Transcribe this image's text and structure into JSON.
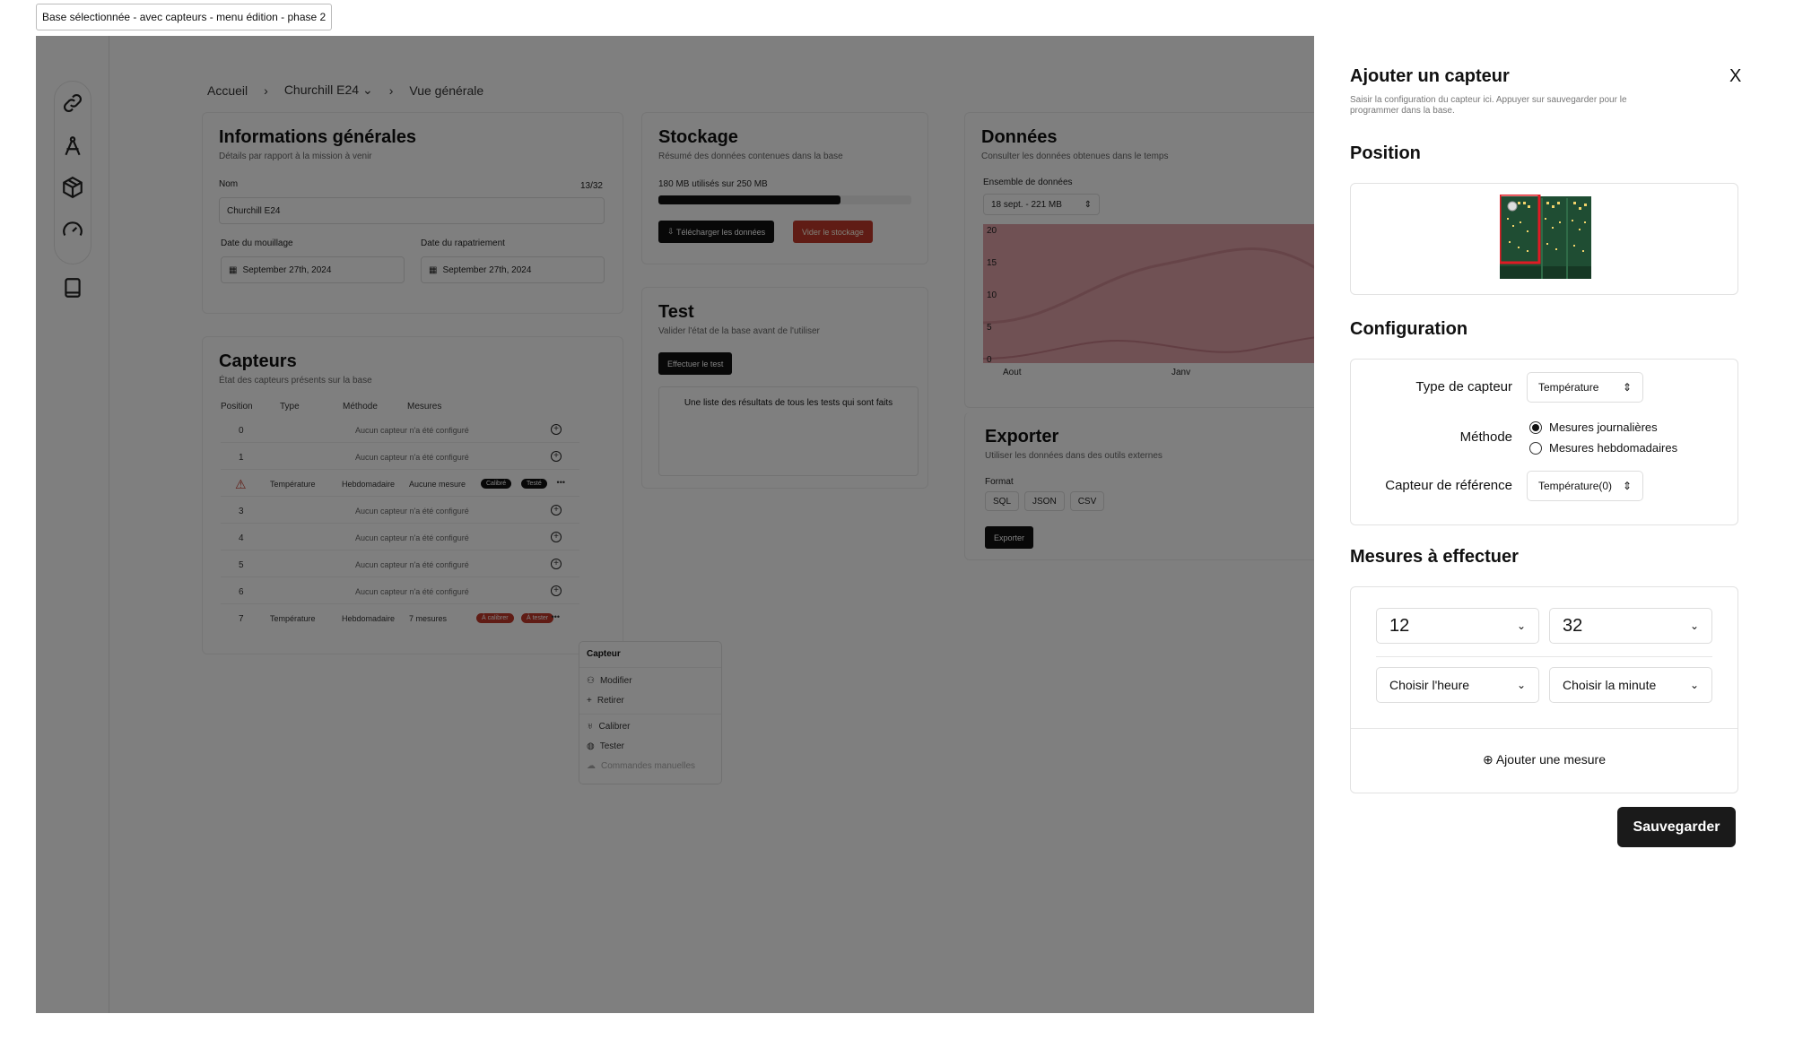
{
  "frame_label": "Base sélectionnée - avec capteurs - menu édition - phase 2",
  "breadcrumb": {
    "home": "Accueil",
    "base": "Churchill E24",
    "page": "Vue générale"
  },
  "general": {
    "title": "Informations générales",
    "subtitle": "Détails par rapport à la mission à venir",
    "name_label": "Nom",
    "name_count": "13/32",
    "name_value": "Churchill E24",
    "mooring_label": "Date du mouillage",
    "mooring_value": "September 27th, 2024",
    "repatriation_label": "Date du rapatriement",
    "repatriation_value": "September 27th, 2024"
  },
  "storage": {
    "title": "Stockage",
    "subtitle": "Résumé des données contenues dans la base",
    "usage": "180 MB utilisés sur 250 MB",
    "usage_fraction": 0.72,
    "download_label": "Télécharger les données",
    "clear_label": "Vider le stockage"
  },
  "test": {
    "title": "Test",
    "subtitle": "Valider l'état de la base avant de l'utiliser",
    "run_label": "Effectuer le test",
    "results_text": "Une liste des résultats de tous les tests qui sont faits"
  },
  "data": {
    "title": "Données",
    "subtitle": "Consulter les données obtenues dans le temps",
    "dataset_label": "Ensemble de données",
    "dataset_value": "18 sept. - 221 MB",
    "y_ticks": [
      "20",
      "15",
      "10",
      "5",
      "0"
    ],
    "x_ticks": [
      "Aout",
      "Janv"
    ],
    "area_color": "#e0a3a9"
  },
  "export": {
    "title": "Exporter",
    "subtitle": "Utiliser les données dans des outils externes",
    "format_label": "Format",
    "formats": [
      "SQL",
      "JSON",
      "CSV"
    ],
    "export_label": "Exporter"
  },
  "sensors": {
    "title": "Capteurs",
    "subtitle": "État des capteurs présents sur la base",
    "headers": [
      "Position",
      "Type",
      "Méthode",
      "Mesures"
    ],
    "empty_text": "Aucun capteur n'a été configuré",
    "rows": [
      {
        "pos": "0"
      },
      {
        "pos": "1"
      },
      {
        "type": "Température",
        "method": "Hebdomadaire",
        "measures": "Aucune mesure",
        "chips": [
          "Calibré",
          "Testé"
        ]
      },
      {
        "pos": "3"
      },
      {
        "pos": "4"
      },
      {
        "pos": "5"
      },
      {
        "pos": "6"
      },
      {
        "pos": "7",
        "type": "Température",
        "method": "Hebdomadaire",
        "measures": "7 mesures",
        "chips": [
          "À calibrer",
          "À tester"
        ]
      }
    ],
    "more_glyph": "•••"
  },
  "context_menu": {
    "title": "Capteur",
    "items": [
      "Modifier",
      "Retirer",
      "Calibrer",
      "Tester",
      "Commandes manuelles"
    ]
  },
  "panel": {
    "title": "Ajouter un capteur",
    "close": "X",
    "description": "Saisir la configuration du capteur ici. Appuyer sur sauvegarder pour le programmer dans la base.",
    "position_title": "Position",
    "config_title": "Configuration",
    "type_label": "Type de capteur",
    "type_value": "Température",
    "method_label": "Méthode",
    "method_options": [
      "Mesures journalières",
      "Mesures hebdomadaires"
    ],
    "method_selected": 0,
    "reference_label": "Capteur de référence",
    "reference_value": "Température(0)",
    "measures_title": "Mesures à effectuer",
    "hour_value": "12",
    "minute_value": "32",
    "hour_placeholder": "Choisir l'heure",
    "minute_placeholder": "Choisir la minute",
    "add_measure": "Ajouter une mesure",
    "save_label": "Sauvegarder"
  },
  "colors": {
    "accent_red": "#c0392b",
    "dark": "#111111",
    "pcb_green": "#1f4d33",
    "highlight": "#e01b24"
  }
}
